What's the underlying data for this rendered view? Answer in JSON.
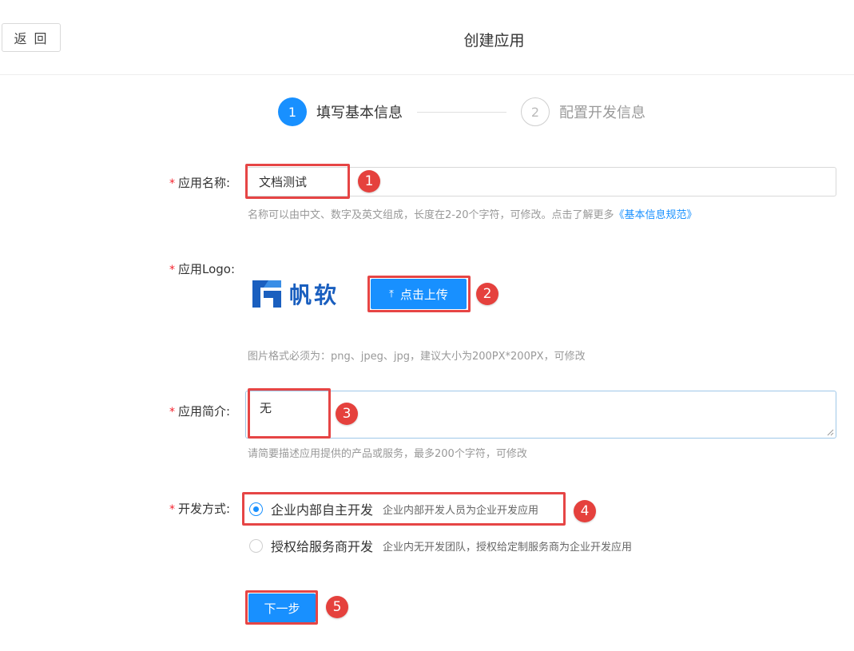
{
  "header": {
    "back_label": "返 回",
    "title": "创建应用"
  },
  "steps": [
    {
      "number": "1",
      "label": "填写基本信息",
      "active": true
    },
    {
      "number": "2",
      "label": "配置开发信息",
      "active": false
    }
  ],
  "form": {
    "required_mark": "*",
    "app_name": {
      "label": "应用名称:",
      "value": "文档测试",
      "hint": "名称可以由中文、数字及英文组成，长度在2-20个字符，可修改。点击了解更多",
      "hint_link": "《基本信息规范》"
    },
    "app_logo": {
      "label": "应用Logo:",
      "logo_text": "帆软",
      "upload_label": "点击上传",
      "hint": "图片格式必须为：png、jpeg、jpg，建议大小为200PX*200PX，可修改"
    },
    "app_intro": {
      "label": "应用简介:",
      "value": "无",
      "hint": "请简要描述应用提供的产品或服务，最多200个字符，可修改"
    },
    "dev_mode": {
      "label": "开发方式:",
      "options": [
        {
          "label": "企业内部自主开发",
          "desc": "企业内部开发人员为企业开发应用",
          "checked": true
        },
        {
          "label": "授权给服务商开发",
          "desc": "企业内无开发团队，授权给定制服务商为企业开发应用",
          "checked": false
        }
      ]
    },
    "next_label": "下一步"
  },
  "annotations": [
    "1",
    "2",
    "3",
    "4",
    "5"
  ],
  "colors": {
    "primary": "#1890ff",
    "highlight": "#e64545",
    "badge": "#e5413d",
    "brand_logo": "#1a5fbf"
  }
}
